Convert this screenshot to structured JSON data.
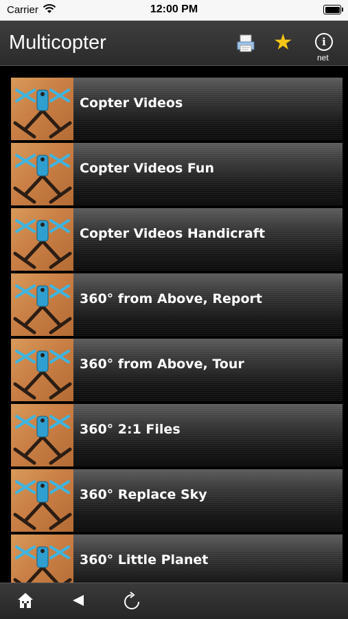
{
  "status_bar": {
    "carrier": "Carrier",
    "time": "12:00 PM"
  },
  "navbar": {
    "title": "Multicopter",
    "info_label": "net"
  },
  "list": {
    "items": [
      {
        "label": "Copter Videos"
      },
      {
        "label": "Copter Videos Fun"
      },
      {
        "label": "Copter Videos Handicraft"
      },
      {
        "label": "360° from Above, Report"
      },
      {
        "label": "360° from Above, Tour"
      },
      {
        "label": "360° 2:1 Files"
      },
      {
        "label": "360° Replace Sky"
      },
      {
        "label": "360° Little Planet"
      }
    ]
  },
  "colors": {
    "accent_star": "#f5c518",
    "nav_bg": "#333333",
    "row_bg": "#2a2a2a"
  },
  "icons": [
    "wifi-icon",
    "battery-icon",
    "print-icon",
    "star-icon",
    "info-icon",
    "home-icon",
    "back-icon",
    "reload-icon"
  ]
}
